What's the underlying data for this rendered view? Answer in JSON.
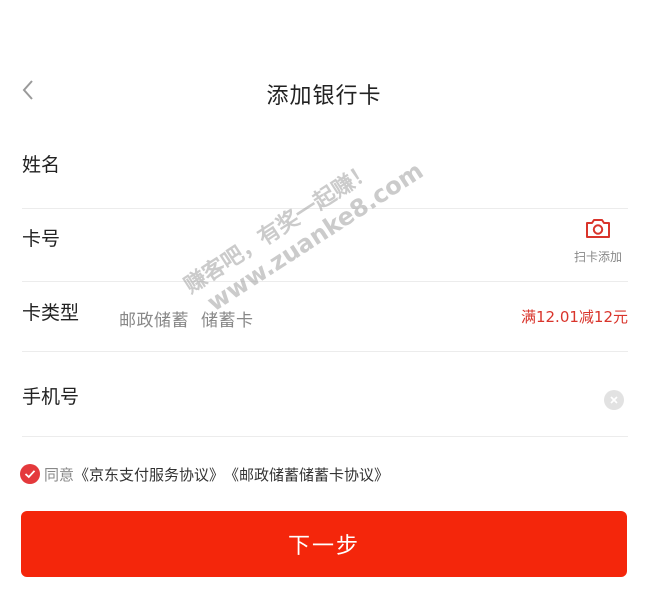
{
  "header": {
    "title": "添加银行卡",
    "back_icon": "chevron-left-icon"
  },
  "form": {
    "name_label": "姓名",
    "card_number_label": "卡号",
    "scan_label": "扫卡添加",
    "card_type_label": "卡类型",
    "card_type_bank": "邮政储蓄",
    "card_type_kind": "储蓄卡",
    "promo_text": "满12.01减12元",
    "phone_label": "手机号"
  },
  "agreement": {
    "agree_text": "同意",
    "link1": "《京东支付服务协议》",
    "link2": "《邮政储蓄储蓄卡协议》"
  },
  "next_button": "下一步",
  "watermark": {
    "line1": "赚客吧，有奖一起赚！",
    "line2": "www.zuanke8.com"
  },
  "colors": {
    "accent": "#f4260b",
    "promo": "#d9342b",
    "check": "#e4393c"
  }
}
